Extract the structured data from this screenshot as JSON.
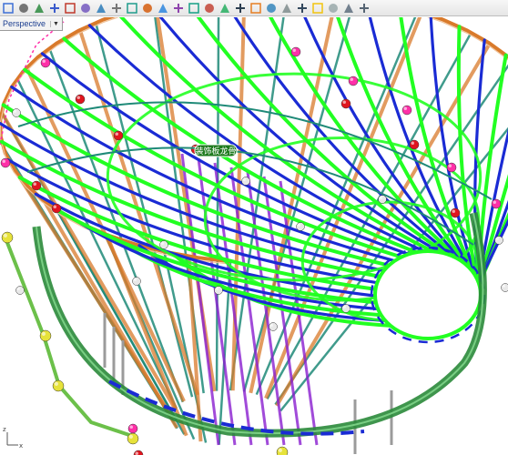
{
  "toolbar": {
    "icons": [
      "select-icon",
      "pan-icon",
      "rotate-icon",
      "zoom-window-icon",
      "zoom-extents-icon",
      "named-view-icon",
      "move-icon",
      "copy-icon",
      "points-icon",
      "curve-icon",
      "render-icon",
      "box-icon",
      "cylinder-icon",
      "cone-icon",
      "surface-icon",
      "boolean-icon",
      "osnap-icon",
      "polyline-icon",
      "arc-icon",
      "circle-icon",
      "light-icon",
      "lock-icon",
      "layer-icon",
      "grid-icon"
    ]
  },
  "viewport": {
    "title": "Perspective",
    "menu_glyph": "▼",
    "label": "装饰板龙骨",
    "axis_x": "x",
    "axis_z": "z"
  },
  "colors": {
    "green_rib": "#22ff22",
    "blue_rib": "#1a2bd4",
    "orange_frame": "#d97a2b",
    "teal_frame": "#1f8a78",
    "purple": "#8a1fd0",
    "pink": "#ff2fa8",
    "red": "#e0151e",
    "yellow": "#e6e23a",
    "ring_green": "#2a8a3a"
  }
}
